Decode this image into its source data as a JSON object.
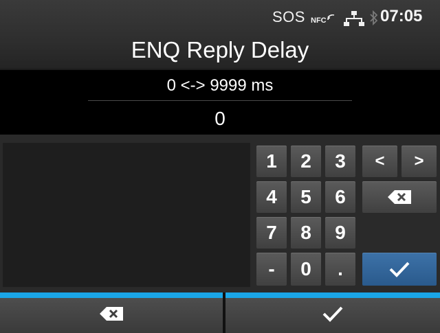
{
  "status": {
    "sos": "SOS",
    "time": "07:05"
  },
  "title": "ENQ Reply Delay",
  "range": "0 <-> 9999 ms",
  "value": "0",
  "keypad": {
    "k1": "1",
    "k2": "2",
    "k3": "3",
    "k4": "4",
    "k5": "5",
    "k6": "6",
    "k7": "7",
    "k8": "8",
    "k9": "9",
    "minus": "-",
    "k0": "0",
    "dot": ".",
    "left": "<",
    "right": ">"
  },
  "colors": {
    "accent": "#1aa6e8",
    "enter": "#2f6498"
  },
  "icons": [
    "nfc-icon",
    "network-icon",
    "bluetooth-icon",
    "backspace-icon",
    "check-icon"
  ]
}
